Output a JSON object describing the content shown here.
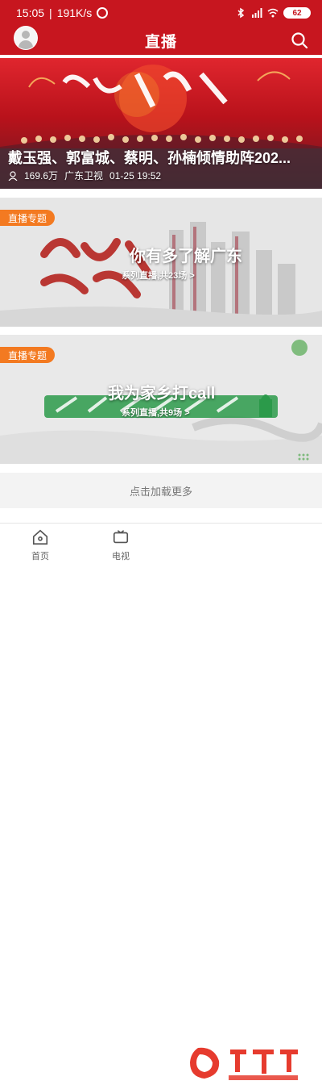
{
  "status_bar": {
    "time": "15:05",
    "network_speed": "191K/s",
    "battery": "62"
  },
  "app_bar": {
    "title": "直播"
  },
  "cards": [
    {
      "title": "戴玉强、郭富城、蔡明、孙楠倾情助阵202...",
      "viewers": "169.6万",
      "channel": "广东卫视",
      "time": "01-25 19:52"
    },
    {
      "tag": "直播专题",
      "title": "你有多了解广东",
      "subtitle": "系列直播,共23场 >"
    },
    {
      "tag": "直播专题",
      "title": "我为家乡打call",
      "subtitle": "系列直播,共9场 >"
    }
  ],
  "load_more": "点击加载更多",
  "tabs": [
    {
      "label": "首页"
    },
    {
      "label": "电视"
    }
  ],
  "colors": {
    "brand_red": "#c7161f",
    "tag_orange": "#f37a21"
  }
}
